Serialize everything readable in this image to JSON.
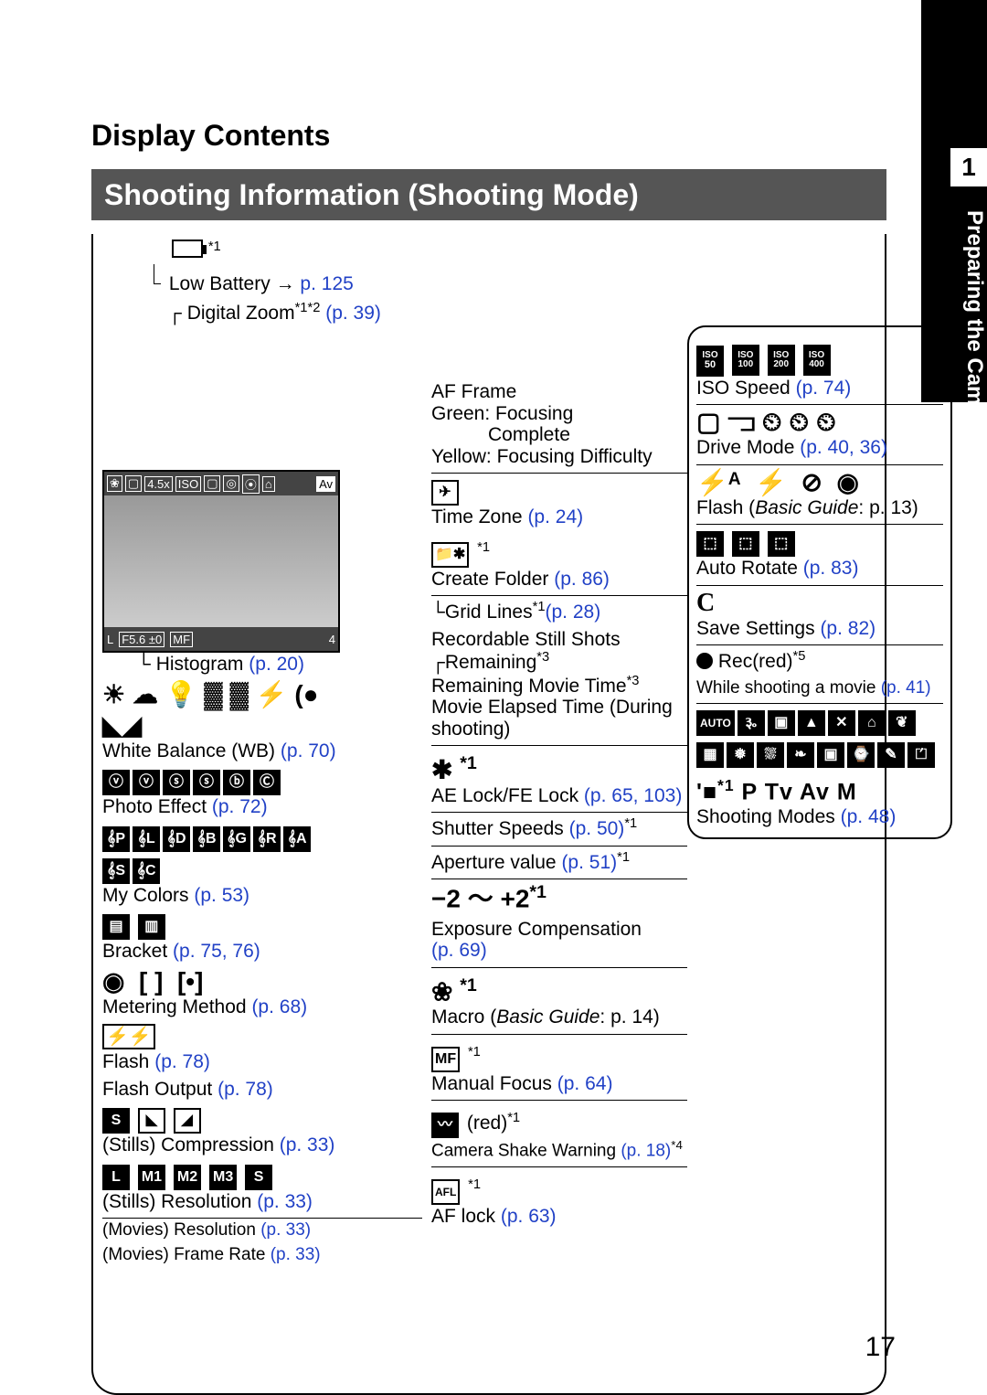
{
  "chapter_number": "1",
  "side_label": "Preparing the Camera",
  "page_title": "Display Contents",
  "subtitle": "Shooting Information (Shooting Mode)",
  "page_number": "17",
  "left": {
    "low_battery": {
      "label": "Low Battery →",
      "page": "p. 125",
      "note": "*1"
    },
    "digital_zoom": {
      "label": "Digital Zoom",
      "note": "*1*2",
      "page": "(p. 39)"
    },
    "histogram": {
      "label": "Histogram",
      "page": "(p. 20)"
    },
    "wb": {
      "label": "White Balance (WB)",
      "page": "(p. 70)"
    },
    "photo_effect": {
      "label": "Photo Effect",
      "page": "(p. 72)"
    },
    "my_colors": {
      "label": "My Colors",
      "page": "(p. 53)"
    },
    "bracket": {
      "label": "Bracket",
      "page": "(p. 75, 76)"
    },
    "metering": {
      "label": "Metering Method",
      "page": "(p. 68)"
    },
    "flash": {
      "label": "Flash",
      "page": "(p. 78)"
    },
    "flash_output": {
      "label": "Flash Output",
      "page": "(p. 78)"
    },
    "stills_comp": {
      "label": "(Stills) Compression",
      "page": "(p. 33)"
    },
    "stills_res": {
      "label": "(Stills) Resolution",
      "page": "(p. 33)"
    },
    "movies_res": {
      "label": "(Movies) Resolution",
      "page": "(p. 33)"
    },
    "movies_fr": {
      "label": "(Movies) Frame Rate",
      "page": "(p. 33)"
    }
  },
  "mid": {
    "af_frame": {
      "l1": "AF Frame",
      "l2": "Green: Focusing",
      "l3": "Complete",
      "l4": "Yellow: Focusing Difficulty"
    },
    "time_zone": {
      "label": "Time Zone",
      "page": "(p. 24)"
    },
    "create_folder": {
      "label": "Create Folder",
      "page": "(p. 86)",
      "note": "*1"
    },
    "grid_lines": {
      "label": "Grid Lines",
      "note": "*1",
      "page": "(p. 28)"
    },
    "recordable": {
      "l1": "Recordable Still Shots",
      "l2": "Remaining",
      "n2": "*3",
      "l3": "Remaining Movie Time",
      "n3": "*3",
      "l4": "Movie Elapsed Time (During shooting)"
    },
    "ae_lock": {
      "note": "*1",
      "label": "AE Lock/FE Lock",
      "page": "(p. 65, 103)"
    },
    "shutter": {
      "label": "Shutter Speeds",
      "page": "(p. 50)",
      "note": "*1"
    },
    "aperture": {
      "label": "Aperture value",
      "page": "(p. 51)",
      "note": "*1"
    },
    "exp_comp": {
      "range": "−2 ～ +2",
      "note": "*1",
      "label": "Exposure Compensation",
      "page": "(p. 69)"
    },
    "macro": {
      "note": "*1",
      "label": "Macro",
      "guide": "Basic Guide",
      "page": ": p. 14)"
    },
    "manual_focus": {
      "note": "*1",
      "label": "Manual Focus",
      "page": "(p. 64)"
    },
    "shake": {
      "red": "(red)",
      "note1": "*1",
      "label": "Camera Shake Warning",
      "page": "(p.  18)",
      "note4": "*4"
    },
    "af_lock": {
      "note": "*1",
      "label": "AF lock",
      "page": "(p. 63)"
    }
  },
  "right": {
    "iso": {
      "labels": [
        "50",
        "100",
        "200",
        "400"
      ],
      "label": "ISO Speed",
      "page": "(p. 74)"
    },
    "drive": {
      "label": "Drive Mode",
      "page": "(p. 40, 36)"
    },
    "flash": {
      "label": "Flash (",
      "guide": "Basic Guide",
      "page": ": p. 13)"
    },
    "auto_rotate": {
      "label": "Auto Rotate",
      "page": "(p. 83)"
    },
    "c_icon": "C",
    "save_settings": {
      "label": "Save Settings",
      "page": "(p. 82)"
    },
    "rec": {
      "label": "Rec(red)",
      "note": "*5"
    },
    "movie": {
      "label": "While shooting a movie",
      "page": "(p. 41)"
    },
    "modes": {
      "note": "*1",
      "bar": "P Tv Av M"
    },
    "shooting_modes": {
      "label": "Shooting Modes",
      "page": "(p. 48)"
    }
  }
}
